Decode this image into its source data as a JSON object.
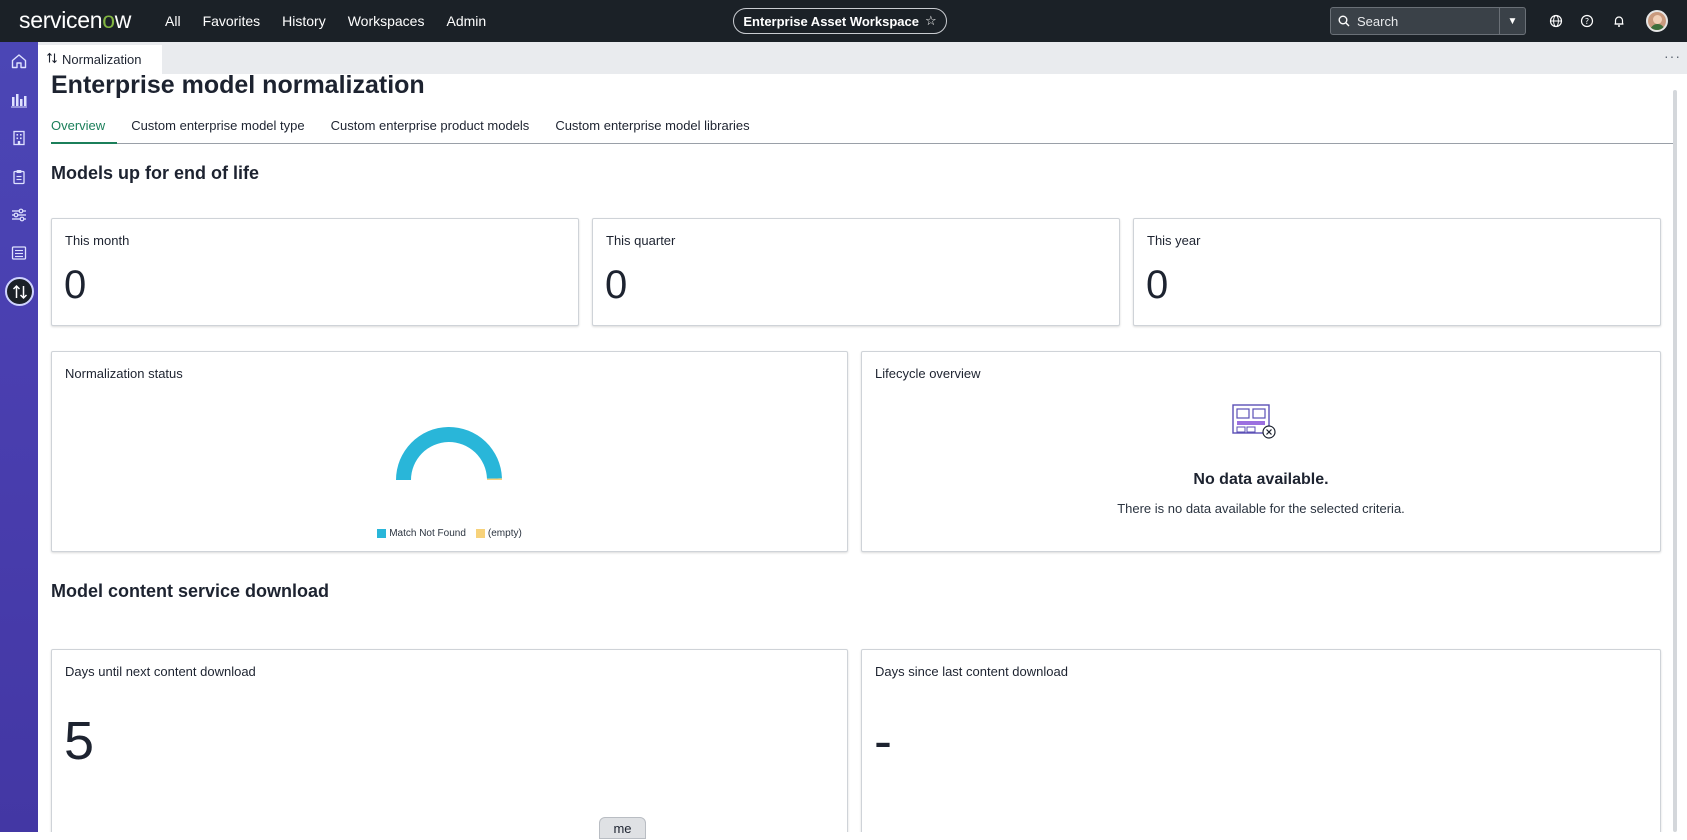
{
  "brand": {
    "pre": "servicen",
    "o": "o",
    "post": "w"
  },
  "topnav": {
    "menu": [
      "All",
      "Favorites",
      "History",
      "Workspaces",
      "Admin"
    ],
    "workspace": "Enterprise Asset Workspace",
    "search_placeholder": "Search"
  },
  "icons": {
    "rail": [
      "home-icon",
      "analytics-icon",
      "building-icon",
      "clipboard-icon",
      "sliders-icon",
      "list-icon",
      "normalization-icon"
    ],
    "top": [
      "globe-icon",
      "help-icon",
      "bell-icon"
    ]
  },
  "tab": {
    "label": "Normalization"
  },
  "page": {
    "title": "Enterprise model normalization",
    "subtabs": [
      "Overview",
      "Custom enterprise model type",
      "Custom enterprise product models",
      "Custom enterprise model libraries"
    ]
  },
  "eol": {
    "heading": "Models up for end of life",
    "cards": [
      {
        "title": "This month",
        "value": "0"
      },
      {
        "title": "This quarter",
        "value": "0"
      },
      {
        "title": "This year",
        "value": "0"
      }
    ]
  },
  "normalization": {
    "title": "Normalization status",
    "legend": [
      {
        "label": "Match Not Found",
        "color": "#29b6d9"
      },
      {
        "label": "(empty)",
        "color": "#f7d27a"
      }
    ]
  },
  "chart_data": {
    "type": "pie",
    "categories": [
      "Match Not Found",
      "(empty)"
    ],
    "values": [
      99,
      1
    ],
    "colors": [
      "#29b6d9",
      "#f7d27a"
    ]
  },
  "lifecycle": {
    "title": "Lifecycle overview",
    "nodata_title": "No data available.",
    "nodata_sub": "There is no data available for the selected criteria."
  },
  "mcs": {
    "heading": "Model content service download",
    "next": {
      "title": "Days until next content download",
      "value": "5"
    },
    "last": {
      "title": "Days since last content download",
      "value": "-"
    }
  },
  "floating": {
    "label": "me"
  }
}
